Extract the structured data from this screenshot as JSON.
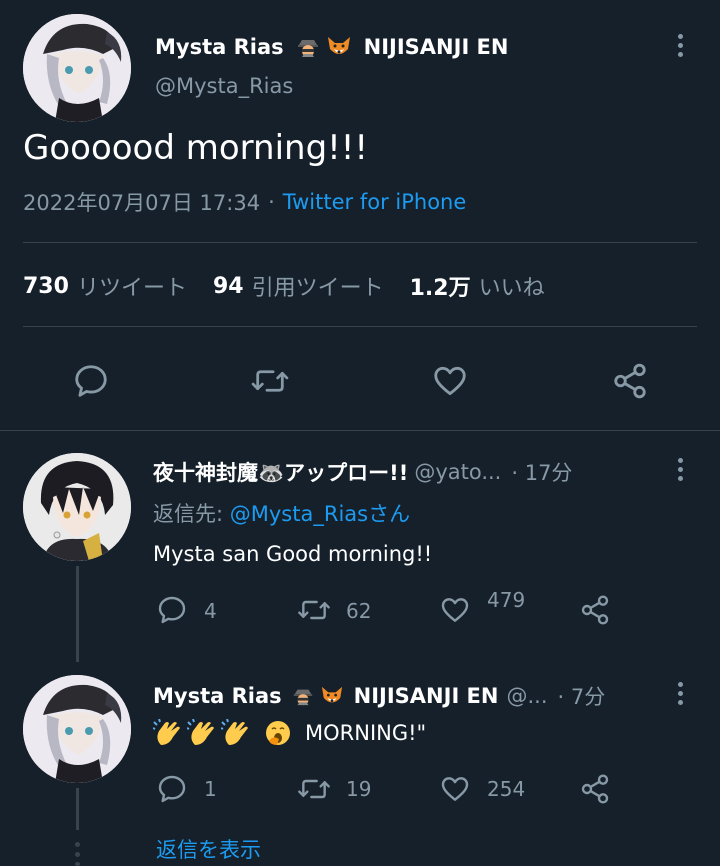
{
  "main_tweet": {
    "display_name": "Mysta Rias",
    "name_suffix": "NIJISANJI EN",
    "handle": "@Mysta_Rias",
    "text": "Goooood morning!!!",
    "timestamp": "2022年07月07日 17:34",
    "separator": "·",
    "source": "Twitter for iPhone",
    "stats": {
      "retweets_count": "730",
      "retweets_label": "リツイート",
      "quotes_count": "94",
      "quotes_label": "引用ツイート",
      "likes_count": "1.2万",
      "likes_label": "いいね"
    }
  },
  "replies": [
    {
      "display_name": "夜十神封魔🦝アップロー!!",
      "handle": "@yato...",
      "time": "· 17分",
      "reply_to_prefix": "返信先: ",
      "reply_to_handle": "@Mysta_Riasさん",
      "text": "Mysta san Good morning!!",
      "reply_count": "4",
      "retweet_count": "62",
      "like_count": "479"
    },
    {
      "display_name": "Mysta Rias",
      "name_suffix": "NIJISANJI EN",
      "handle": "@...",
      "time": "· 7分",
      "text": "MORNING!\"",
      "reply_count": "1",
      "retweet_count": "19",
      "like_count": "254"
    }
  ],
  "show_replies_label": "返信を表示",
  "colors": {
    "background": "#15202b",
    "divider": "#38444d",
    "muted": "#8899a6",
    "link": "#1d9bf0"
  }
}
